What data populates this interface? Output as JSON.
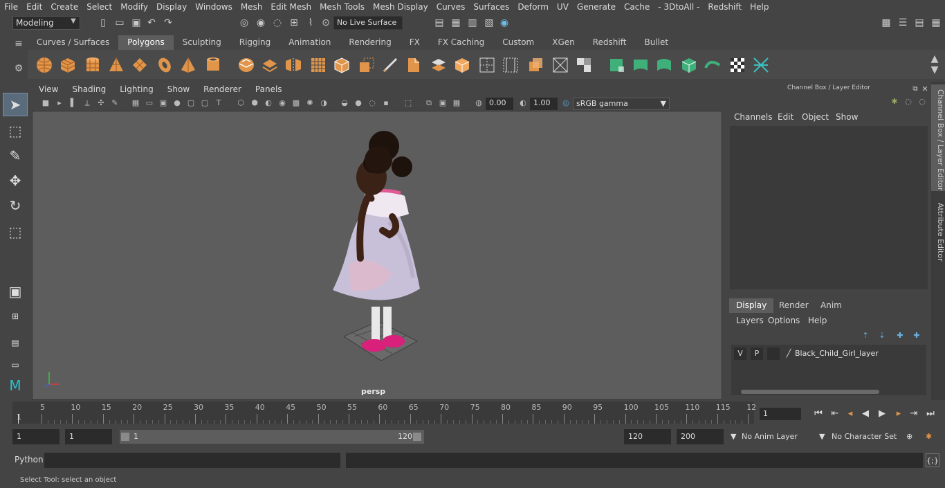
{
  "menubar": {
    "items": [
      "File",
      "Edit",
      "Create",
      "Select",
      "Modify",
      "Display",
      "Windows",
      "Mesh",
      "Edit Mesh",
      "Mesh Tools",
      "Mesh Display",
      "Curves",
      "Surfaces",
      "Deform",
      "UV",
      "Generate",
      "Cache",
      "- 3DtoAll -",
      "Redshift",
      "Help"
    ]
  },
  "statusline": {
    "mode": "Modeling",
    "live_surface": "No Live Surface"
  },
  "shelf": {
    "tabs": [
      "Curves / Surfaces",
      "Polygons",
      "Sculpting",
      "Rigging",
      "Animation",
      "Rendering",
      "FX",
      "FX Caching",
      "Custom",
      "XGen",
      "Redshift",
      "Bullet"
    ],
    "active_tab": "Polygons"
  },
  "viewport": {
    "menus": [
      "View",
      "Shading",
      "Lighting",
      "Show",
      "Renderer",
      "Panels"
    ],
    "exposure": "0.00",
    "gamma": "1.00",
    "color_space": "sRGB gamma",
    "camera_label": "persp"
  },
  "channel_box": {
    "title": "Channel Box / Layer Editor",
    "menus": [
      "Channels",
      "Edit",
      "Object",
      "Show"
    ]
  },
  "layer_editor": {
    "tabs": [
      "Display",
      "Render",
      "Anim"
    ],
    "active_tab": "Display",
    "menus": [
      "Layers",
      "Options",
      "Help"
    ],
    "layer": {
      "v": "V",
      "p": "P",
      "name": "Black_Child_Girl_layer"
    }
  },
  "side_tabs": [
    "Channel Box / Layer Editor",
    "Attribute Editor"
  ],
  "timeline": {
    "ticks": [
      "5",
      "10",
      "15",
      "20",
      "25",
      "30",
      "35",
      "40",
      "45",
      "50",
      "55",
      "60",
      "65",
      "70",
      "75",
      "80",
      "85",
      "90",
      "95",
      "100",
      "105",
      "110",
      "115",
      "12"
    ],
    "start_marker": "1",
    "current_frame": "1"
  },
  "range": {
    "start": "1",
    "anim_start": "1",
    "slider_start": "1",
    "slider_end": "120",
    "end": "120",
    "anim_end": "200",
    "anim_layer": "No Anim Layer",
    "character_set": "No Character Set"
  },
  "python": {
    "label": "Python"
  },
  "status": {
    "message": "Select Tool: select an object"
  }
}
